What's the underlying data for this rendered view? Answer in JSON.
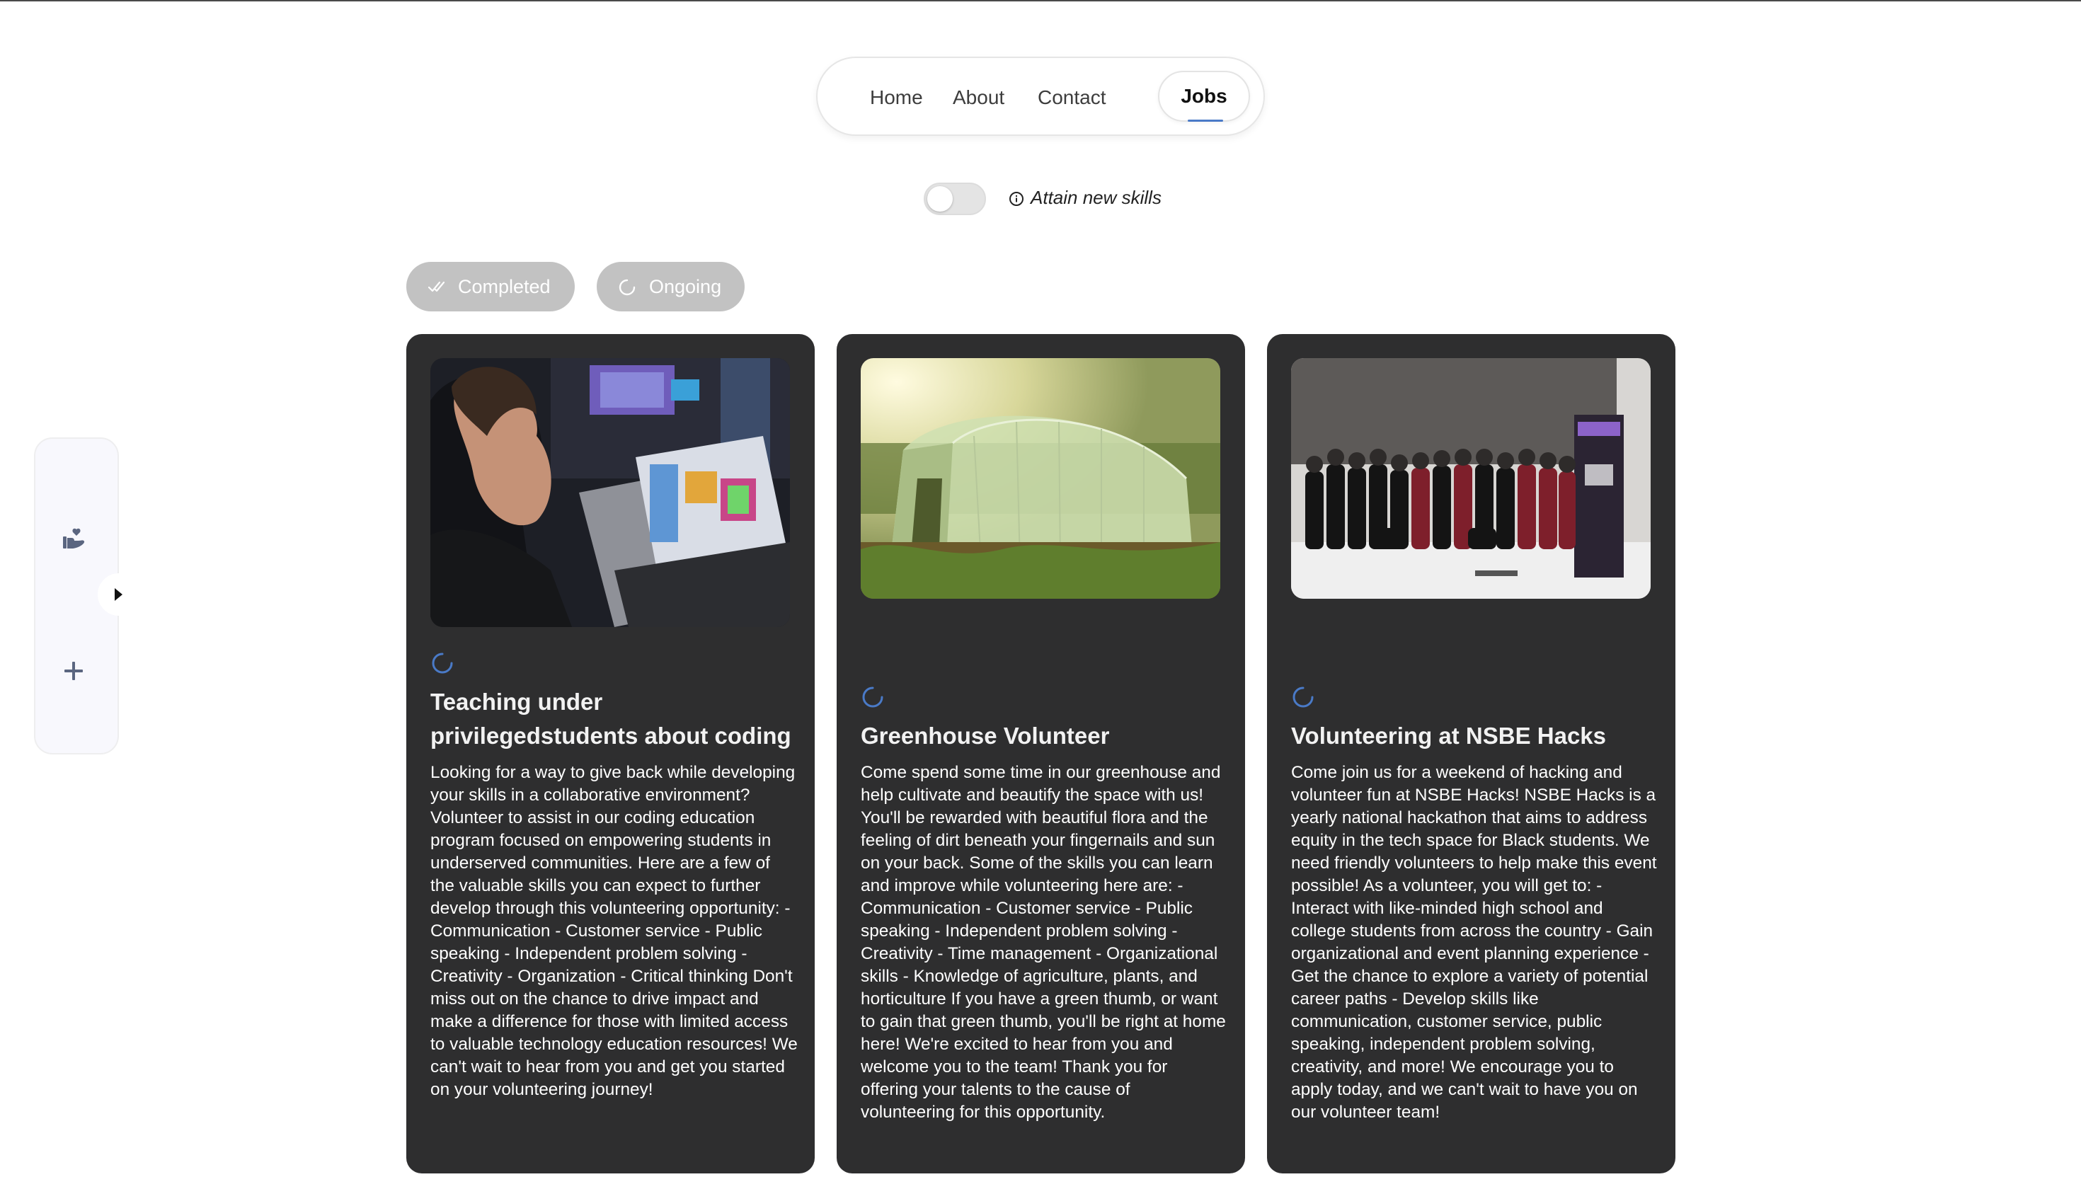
{
  "nav": {
    "links": [
      "Home",
      "About",
      "Contact"
    ],
    "active": "Jobs"
  },
  "toggle": {
    "label": "Attain new skills",
    "state": "off"
  },
  "filters": {
    "completed": "Completed",
    "ongoing": "Ongoing"
  },
  "sidebar": {
    "icons": [
      "hand-heart-icon",
      "plus-icon"
    ],
    "expand_icon": "caret-right-icon"
  },
  "colors": {
    "card_bg": "#2e2e2f",
    "accent": "#4a7ac7",
    "chip_bg": "#c2c2c2"
  },
  "jobs": [
    {
      "title": "Teaching under privilegedstudents about coding",
      "description": "Looking for a way to give back while developing your skills in a collaborative environment? Volunteer to assist in our coding education program focused on empowering students in underserved communities. Here are a few of the valuable skills you can expect to further develop through this volunteering opportunity: - Communication - Customer service - Public speaking - Independent problem solving - Creativity - Organization - Critical thinking Don't miss out on the chance to drive impact and make a difference for those with limited access to valuable technology education resources! We can't wait to hear from you and get you started on your volunteering journey!"
    },
    {
      "title": "Greenhouse Volunteer",
      "description": "Come spend some time in our greenhouse and help cultivate and beautify the space with us! You'll be rewarded with beautiful flora and the feeling of dirt beneath your fingernails and sun on your back. Some of the skills you can learn and improve while volunteering here are: - Communication - Customer service - Public speaking - Independent problem solving - Creativity - Time management - Organizational skills - Knowledge of agriculture, plants, and horticulture If you have a green thumb, or want to gain that green thumb, you'll be right at home here! We're excited to hear from you and welcome you to the team! Thank you for offering your talents to the cause of volunteering for this opportunity."
    },
    {
      "title": "Volunteering at NSBE Hacks",
      "description": "Come join us for a weekend of hacking and volunteer fun at NSBE Hacks! NSBE Hacks is a yearly national hackathon that aims to address equity in the tech space for Black students. We need friendly volunteers to help make this event possible! As a volunteer, you will get to: - Interact with like-minded high school and college students from across the country - Gain organizational and event planning experience - Get the chance to explore a variety of potential career paths - Develop skills like communication, customer service, public speaking, independent problem solving, creativity, and more! We encourage you to apply today, and we can't wait to have you on our volunteer team!"
    }
  ]
}
